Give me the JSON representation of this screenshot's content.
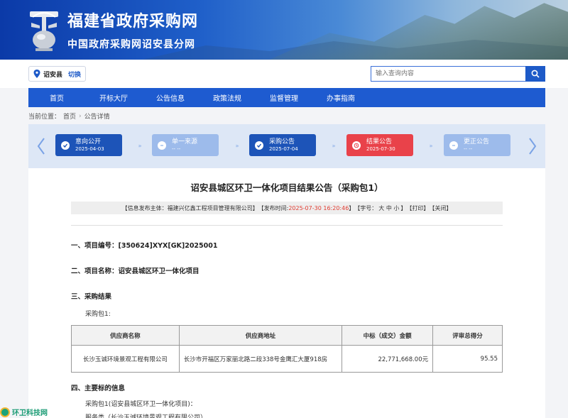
{
  "banner": {
    "title": "福建省政府采购网",
    "subtitle": "中国政府采购网诏安县分网"
  },
  "region": {
    "name": "诏安县",
    "switch_label": "切换"
  },
  "search": {
    "placeholder": "输入查询内容"
  },
  "nav": [
    "首页",
    "开标大厅",
    "公告信息",
    "政策法规",
    "监督管理",
    "办事指南"
  ],
  "breadcrumb": {
    "prefix": "当前位置：",
    "home": "首页",
    "current": "公告详情"
  },
  "timeline": [
    {
      "label": "意向公开",
      "date": "2025-04-03",
      "state": "active"
    },
    {
      "label": "单一来源",
      "date": "-- --",
      "state": "inactive"
    },
    {
      "label": "采购公告",
      "date": "2025-07-04",
      "state": "active"
    },
    {
      "label": "结果公告",
      "date": "2025-07-30",
      "state": "result"
    },
    {
      "label": "更正公告",
      "date": "-- --",
      "state": "inactive"
    }
  ],
  "article": {
    "title": "诏安县城区环卫一体化项目结果公告（采购包1）",
    "info": {
      "publisher_prefix": "【信息发布主体：",
      "publisher": "福建兴亿鑫工程项目管理有限公司",
      "publisher_suffix": "】",
      "time_prefix": "【发布时间:",
      "time": "2025-07-30 16:20:46",
      "time_suffix": "】",
      "font_prefix": "【字号：",
      "font_sizes": "大 中 小",
      "font_suffix": "】",
      "print": "【打印】",
      "close": "【关闭】"
    },
    "sec1": "一、项目编号：[350624]XYX[GK]2025001",
    "sec2": "二、项目名称：诏安县城区环卫一体化项目",
    "sec3": "三、采购结果",
    "package_label": "采购包1:",
    "table": {
      "headers": [
        "供应商名称",
        "供应商地址",
        "中标（成交）金额",
        "评审总得分"
      ],
      "rows": [
        [
          "长沙玉诚环境景观工程有限公司",
          "长沙市开福区万家丽北路二段338号金鹰汇大厦918房",
          "22,771,668.00元",
          "95.55"
        ]
      ]
    },
    "sec4": "四、主要标的信息",
    "sec4_line1": "采购包1(诏安县城区环卫一体化项目)：",
    "sec4_line2": "服务类（长沙玉诚环境景观工程有限公司）"
  },
  "watermark": {
    "text": "环卫科技网"
  },
  "colors": {
    "primary": "#1e5bd0",
    "result_red": "#e9424a",
    "step_inactive": "#9dbbeb"
  }
}
